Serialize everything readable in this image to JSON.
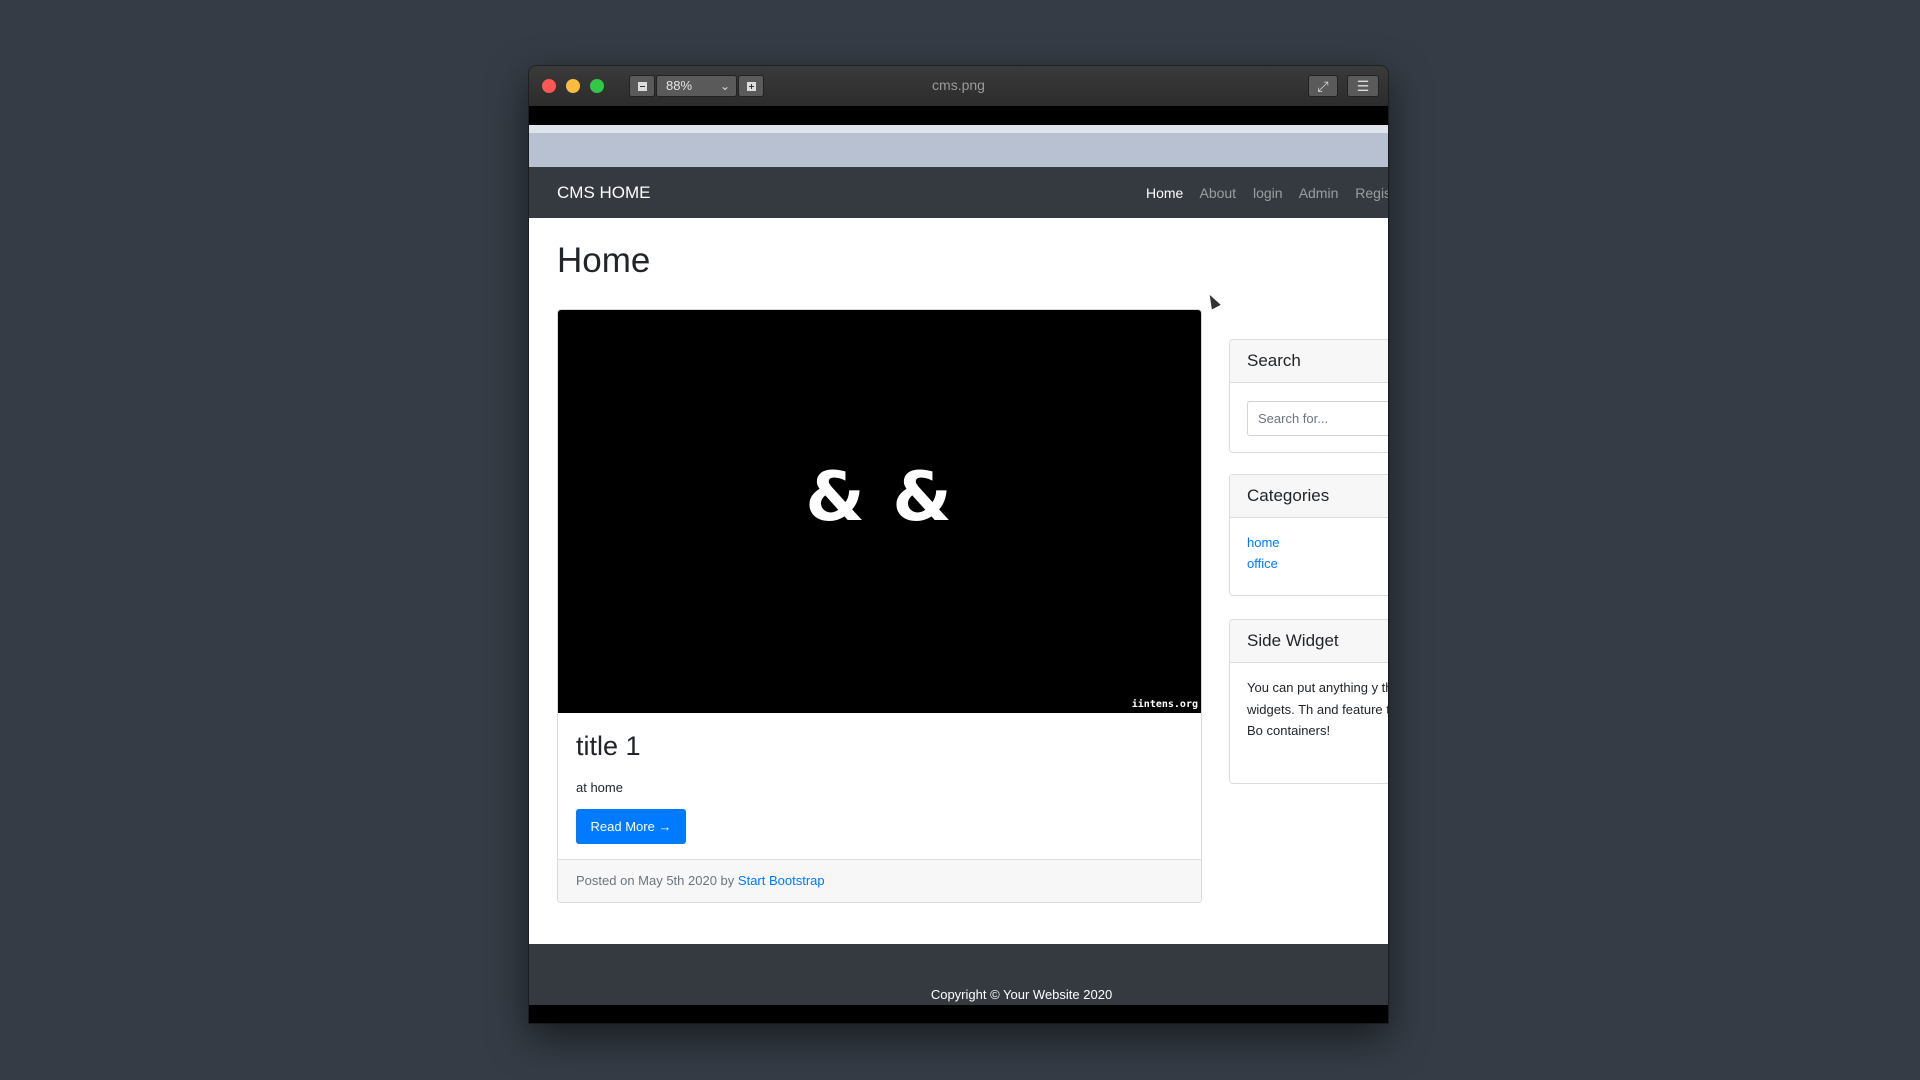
{
  "window": {
    "title": "cms.png",
    "zoom": "88%"
  },
  "navbar": {
    "brand": "CMS HOME",
    "links": [
      "Home",
      "About",
      "login",
      "Admin",
      "Regis"
    ]
  },
  "main": {
    "heading": "Home",
    "post": {
      "image_text": "& &",
      "watermark": "iintens.org",
      "title": "title 1",
      "text": "at home",
      "read_more": "Read More →",
      "footer_prefix": "Posted on May 5th 2020 by",
      "author": "Start Bootstrap"
    }
  },
  "sidebar": {
    "search": {
      "title": "Search",
      "placeholder": "Search for..."
    },
    "categories": {
      "title": "Categories",
      "items": [
        "home",
        "office"
      ]
    },
    "side_widget": {
      "title": "Side Widget",
      "text": "You can put anything y these side widgets. Th and feature the new Bo containers!"
    }
  },
  "footer": {
    "text": "Copyright © Your Website 2020"
  }
}
